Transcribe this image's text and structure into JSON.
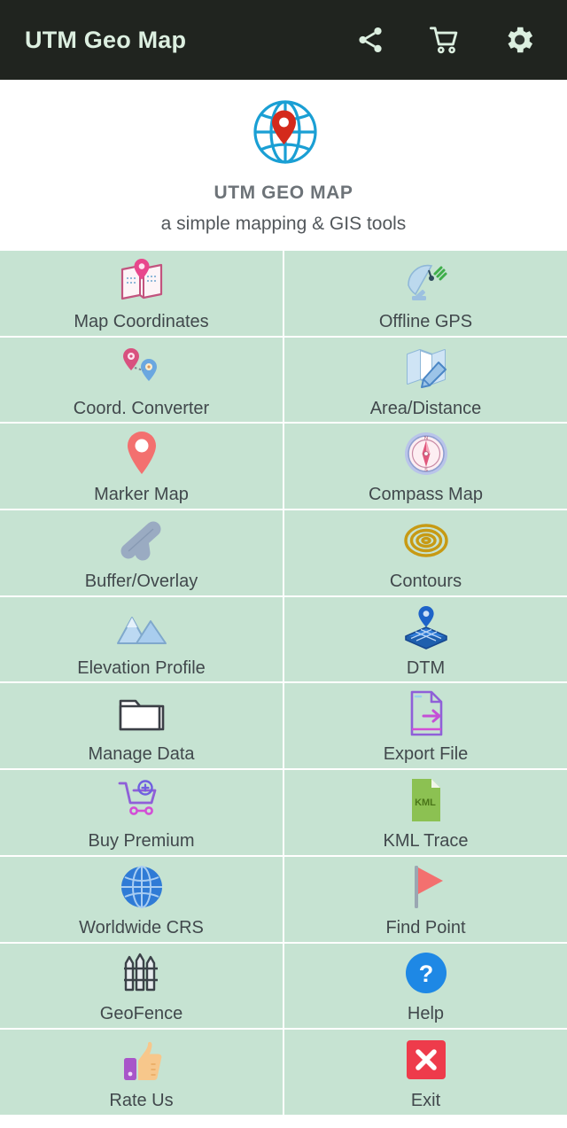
{
  "appbar": {
    "title": "UTM Geo Map",
    "actions": [
      {
        "name": "share-icon",
        "label": "Share"
      },
      {
        "name": "cart-icon",
        "label": "Store"
      },
      {
        "name": "gear-icon",
        "label": "Settings"
      }
    ]
  },
  "header": {
    "logo_icon": "globe-pin-logo",
    "app_name": "UTM GEO MAP",
    "tagline": "a simple mapping & GIS tools"
  },
  "menu": {
    "items": [
      {
        "label": "Map Coordinates",
        "icon": "map-pin-book-icon"
      },
      {
        "label": "Offline GPS",
        "icon": "satellite-dish-icon"
      },
      {
        "label": "Coord. Converter",
        "icon": "two-pins-convert-icon"
      },
      {
        "label": "Area/Distance",
        "icon": "map-pencil-icon"
      },
      {
        "label": "Marker Map",
        "icon": "marker-pin-icon"
      },
      {
        "label": "Compass Map",
        "icon": "compass-icon"
      },
      {
        "label": "Buffer/Overlay",
        "icon": "buffer-shape-icon"
      },
      {
        "label": "Contours",
        "icon": "contour-spiral-icon"
      },
      {
        "label": "Elevation Profile",
        "icon": "mountains-icon"
      },
      {
        "label": "DTM",
        "icon": "terrain-grid-pin-icon"
      },
      {
        "label": "Manage Data",
        "icon": "folder-icon"
      },
      {
        "label": "Export File",
        "icon": "file-export-icon"
      },
      {
        "label": "Buy Premium",
        "icon": "cart-plus-icon"
      },
      {
        "label": "KML Trace",
        "icon": "kml-file-icon"
      },
      {
        "label": "Worldwide CRS",
        "icon": "globe-icon"
      },
      {
        "label": "Find Point",
        "icon": "flag-icon"
      },
      {
        "label": "GeoFence",
        "icon": "fence-icon"
      },
      {
        "label": "Help",
        "icon": "question-circle-icon"
      },
      {
        "label": "Rate Us",
        "icon": "thumbs-up-icon"
      },
      {
        "label": "Exit",
        "icon": "exit-x-icon"
      }
    ]
  },
  "colors": {
    "appbar_bg": "#20241f",
    "appbar_fg": "#dcefe0",
    "cell_bg": "#c6e3d2",
    "cell_divider": "#ffffff",
    "label_fg": "#41484c",
    "app_name_fg": "#6d7378",
    "logo_globe": "#1a9fd4",
    "logo_pin": "#d42a1c"
  }
}
